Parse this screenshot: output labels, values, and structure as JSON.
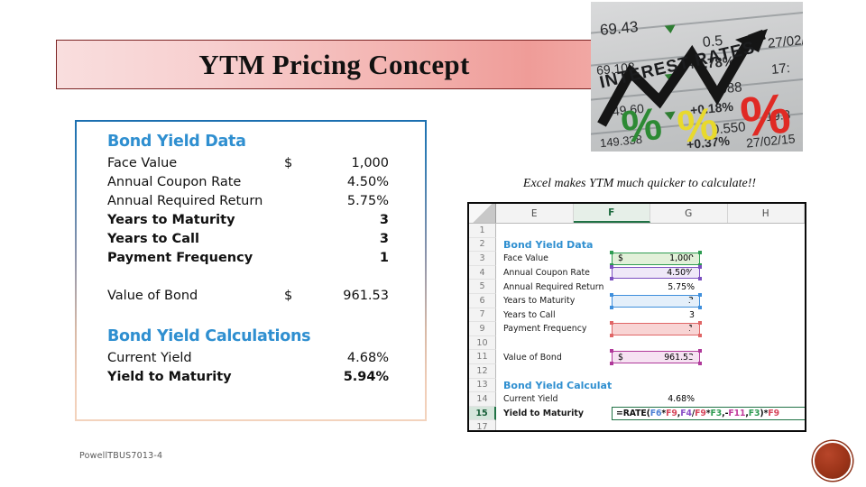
{
  "slide": {
    "title": "YTM Pricing Concept",
    "footer": "PowellTBUS7013-4",
    "accent_banner_border": "#7b2222",
    "accent_heading_blue": "#2f8fd0",
    "seal_color": "#9c3419"
  },
  "bond_box": {
    "section1_title": "Bond Yield Data",
    "rows": [
      {
        "label": "Face Value",
        "currency": "$",
        "value": "1,000"
      },
      {
        "label": "Annual Coupon Rate",
        "currency": "",
        "value": "4.50%"
      },
      {
        "label": "Annual Required Return",
        "currency": "",
        "value": "5.75%"
      },
      {
        "label": "Years to Maturity",
        "currency": "",
        "value": "3"
      },
      {
        "label": "Years to Call",
        "currency": "",
        "value": "3"
      },
      {
        "label": "Payment Frequency",
        "currency": "",
        "value": "1"
      }
    ],
    "value_of_bond": {
      "label": "Value of Bond",
      "currency": "$",
      "value": "961.53"
    },
    "section2_title": "Bond Yield Calculations",
    "calc_rows": [
      {
        "label": "Current Yield",
        "value": "4.68%",
        "bold": false
      },
      {
        "label": "Yield to Maturity",
        "value": "5.94%",
        "bold": true
      }
    ]
  },
  "excel": {
    "caption": "Excel makes YTM much quicker to calculate!!",
    "columns": [
      "E",
      "F",
      "G",
      "H"
    ],
    "active_column": "F",
    "selected_row": "15",
    "rows": [
      {
        "num": "1",
        "e": "",
        "f": "",
        "style": "plain",
        "trace": ""
      },
      {
        "num": "2",
        "e": "Bond Yield Data",
        "f": "",
        "style": "head",
        "trace": ""
      },
      {
        "num": "3",
        "e": "Face Value",
        "f": "1,000",
        "style": "plain",
        "trace": "green",
        "currency": "$"
      },
      {
        "num": "4",
        "e": "Annual Coupon Rate",
        "f": "4.50%",
        "style": "plain",
        "trace": "purple"
      },
      {
        "num": "5",
        "e": "Annual Required Return",
        "f": "5.75%",
        "style": "plain",
        "trace": ""
      },
      {
        "num": "6",
        "e": "Years to Maturity",
        "f": "3",
        "style": "plain",
        "trace": "blue"
      },
      {
        "num": "7",
        "e": "Years to Call",
        "f": "3",
        "style": "plain",
        "trace": ""
      },
      {
        "num": "9",
        "e": "Payment Frequency",
        "f": "1",
        "style": "plain",
        "trace": "red"
      },
      {
        "num": "10",
        "e": "",
        "f": "",
        "style": "plain",
        "trace": ""
      },
      {
        "num": "11",
        "e": "Value of Bond",
        "f": "961.53",
        "style": "plain",
        "trace": "magenta",
        "currency": "$"
      },
      {
        "num": "12",
        "e": "",
        "f": "",
        "style": "plain",
        "trace": ""
      },
      {
        "num": "13",
        "e": "Bond Yield Calculations",
        "f": "",
        "style": "head",
        "trace": ""
      },
      {
        "num": "14",
        "e": "Current Yield",
        "f": "4.68%",
        "style": "plain",
        "trace": ""
      },
      {
        "num": "15",
        "e": "Yield to Maturity",
        "f": "",
        "style": "bold",
        "trace": "formula"
      },
      {
        "num": "17",
        "e": "",
        "f": "",
        "style": "plain",
        "trace": ""
      }
    ],
    "formula": {
      "full": "=RATE(F6*F9,F4/F9*F3,-F11,F3)*F9",
      "tokens": [
        {
          "t": "=RATE(",
          "c": "black"
        },
        {
          "t": "F6",
          "c": "blue"
        },
        {
          "t": "*",
          "c": "black"
        },
        {
          "t": "F9",
          "c": "red"
        },
        {
          "t": ",",
          "c": "black"
        },
        {
          "t": "F4",
          "c": "purple"
        },
        {
          "t": "/",
          "c": "black"
        },
        {
          "t": "F9",
          "c": "red"
        },
        {
          "t": "*",
          "c": "black"
        },
        {
          "t": "F3",
          "c": "green"
        },
        {
          "t": ",-",
          "c": "black"
        },
        {
          "t": "F11",
          "c": "magenta"
        },
        {
          "t": ",",
          "c": "black"
        },
        {
          "t": "F3",
          "c": "green"
        },
        {
          "t": ")*",
          "c": "black"
        },
        {
          "t": "F9",
          "c": "red"
        }
      ]
    }
  },
  "photo": {
    "label": "INTEREST RATES",
    "numbers": [
      "69.43",
      "69.108",
      "149.60",
      "149.338",
      "0.5",
      "0.088",
      "0.550",
      "17:",
      "27/02/",
      "27/02/15",
      "19.3"
    ],
    "percents": [
      "+0.78%",
      "+0.18%",
      "+0.37%"
    ],
    "pct_glyph": "%"
  }
}
